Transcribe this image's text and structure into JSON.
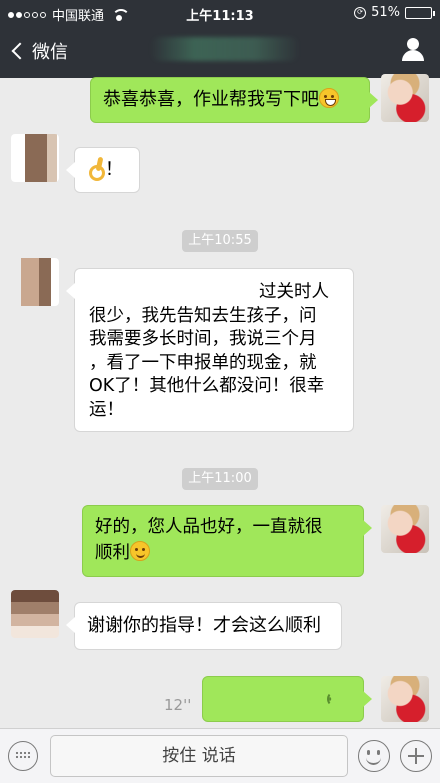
{
  "status_bar": {
    "carrier": "中国联通",
    "time": "上午11:13",
    "battery": "51%",
    "battery_level": 0.51,
    "signal_dots_filled": 2,
    "signal_dots_total": 5
  },
  "nav": {
    "back_label": "微信",
    "contact_name_obscured": true
  },
  "messages": [
    {
      "side": "me",
      "type": "text",
      "text": "恭喜恭喜，作业帮我写下吧",
      "emoji": "grin-emoji"
    },
    {
      "side": "other",
      "type": "text",
      "text": "！",
      "emoji": "ok-hand-emoji"
    },
    {
      "type": "timestamp",
      "text": "上午10:55"
    },
    {
      "side": "other",
      "type": "text",
      "lines": [
        "过关时人",
        "很少，我先告知去生孩子，问",
        "我需要多长时间，我说三个月",
        "，看了一下申报单的现金，就",
        "OK了！其他什么都没问！很幸",
        "运！"
      ]
    },
    {
      "type": "timestamp",
      "text": "上午11:00"
    },
    {
      "side": "me",
      "type": "text",
      "lines": [
        "好的，您人品也好，一直就很",
        "顺利"
      ],
      "emoji": "smile-emoji"
    },
    {
      "side": "other",
      "type": "text",
      "text": "谢谢你的指导！才会这么顺利"
    },
    {
      "side": "me",
      "type": "voice",
      "duration": "12''"
    }
  ],
  "input_bar": {
    "hold_to_talk": "按住 说话"
  },
  "colors": {
    "nav_bg": "#2e3238",
    "chat_bg": "#ebebeb",
    "my_bubble": "#a0e75a",
    "their_bubble": "#ffffff"
  }
}
